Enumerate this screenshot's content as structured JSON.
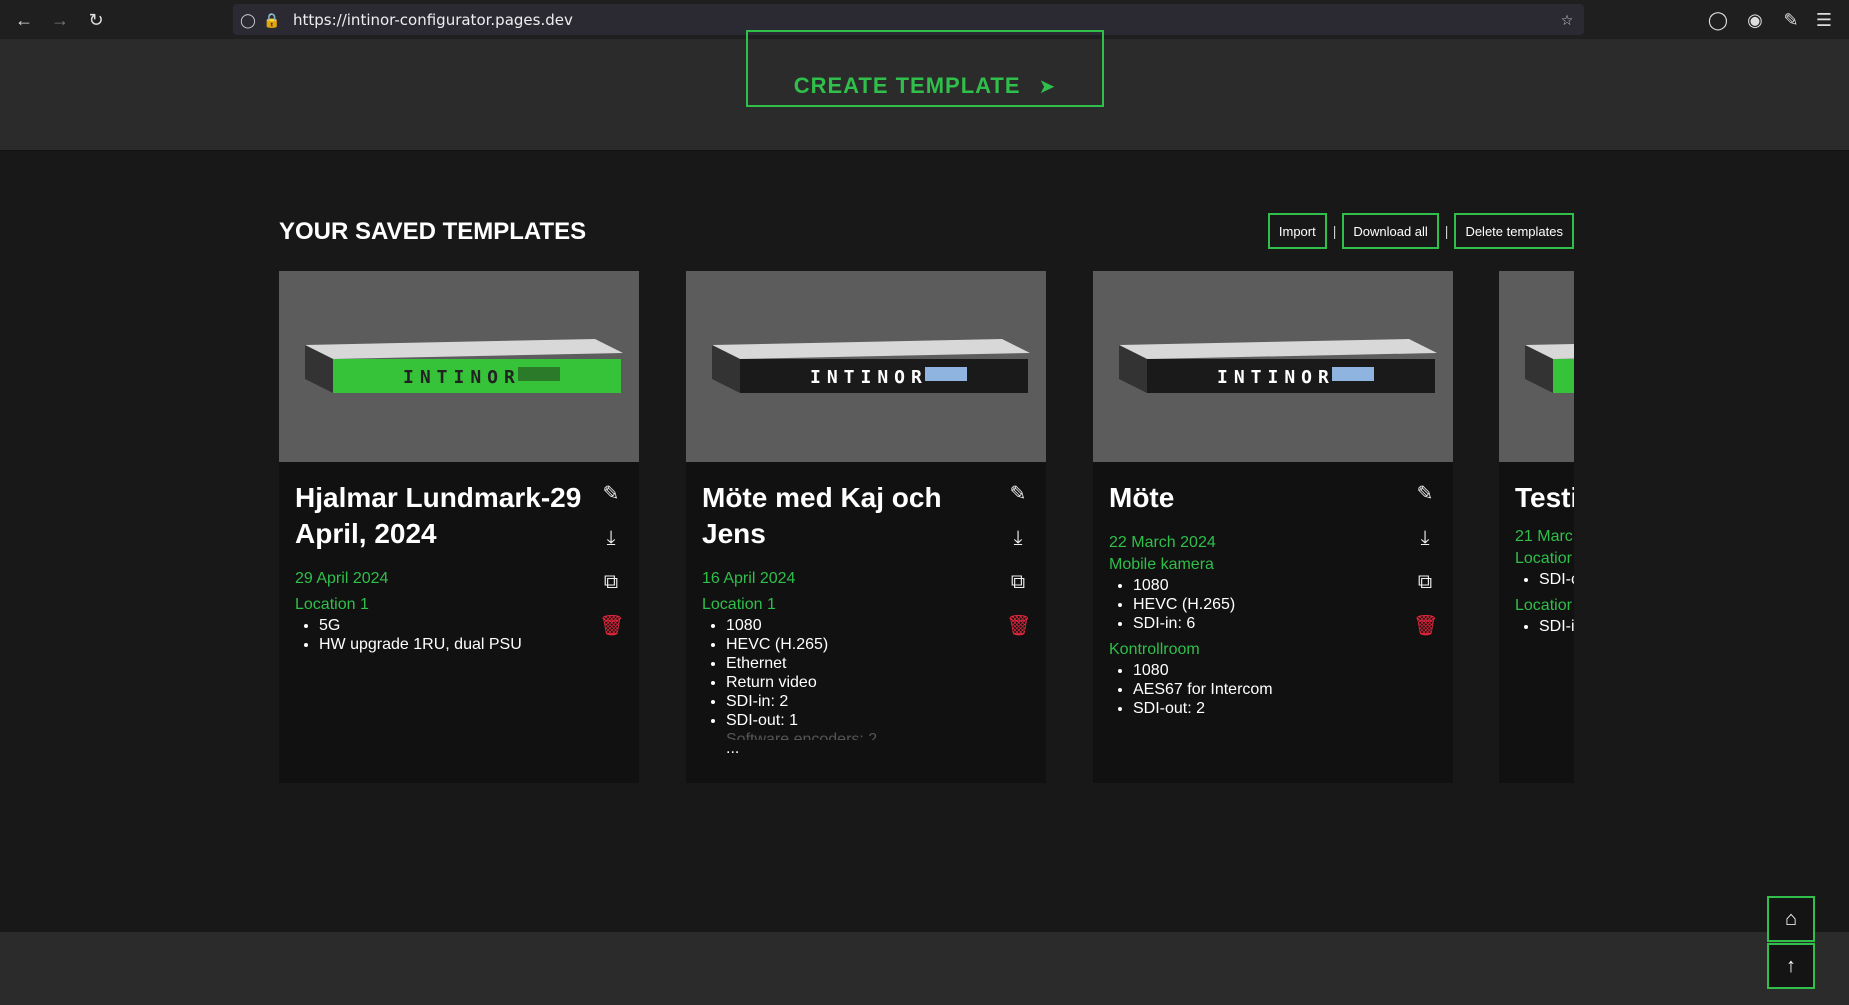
{
  "browser": {
    "url": "https://intinor-configurator.pages.dev"
  },
  "top": {
    "create_button_label": "CREATE TEMPLATE"
  },
  "saved": {
    "title": "YOUR SAVED TEMPLATES",
    "actions": {
      "import": "Import",
      "download_all": "Download all",
      "delete_templates": "Delete templates",
      "separator": "|"
    }
  },
  "cards": [
    {
      "title": "Hjalmar Lundmark-29 April, 2024",
      "date": "29 April 2024",
      "device_color": "#37c339",
      "locations": [
        {
          "name": "Location 1",
          "items": [
            "5G",
            "HW upgrade 1RU, dual PSU"
          ]
        }
      ]
    },
    {
      "title": "Möte med Kaj och Jens",
      "date": "16 April 2024",
      "device_color": "#1a1a1a",
      "locations": [
        {
          "name": "Location 1",
          "items": [
            "1080",
            "HEVC (H.265)",
            "Ethernet",
            "Return video",
            "SDI-in: 2",
            "SDI-out: 1"
          ]
        }
      ],
      "faded_item": "Software encoders: 2",
      "more": "..."
    },
    {
      "title": "Möte",
      "date": "22 March 2024",
      "device_color": "#1a1a1a",
      "locations": [
        {
          "name": "Mobile kamera",
          "items": [
            "1080",
            "HEVC (H.265)",
            "SDI-in: 6"
          ]
        },
        {
          "name": "Kontrollroom",
          "items": [
            "1080",
            "AES67 for Intercom",
            "SDI-out: 2"
          ]
        }
      ]
    },
    {
      "title": "Testi",
      "date": "21 Marc",
      "device_color": "#37c339",
      "locations": [
        {
          "name": "Locatior",
          "items": [
            "SDI-c"
          ]
        },
        {
          "name": "Locatior",
          "items": [
            "SDI-i"
          ]
        }
      ]
    }
  ],
  "icons": {
    "edit": "pencil-icon",
    "download": "download-icon",
    "copy": "copy-icon",
    "delete": "trash-icon",
    "home": "home-icon",
    "up": "arrow-up-icon"
  },
  "colors": {
    "accent": "#2fbf4a",
    "delete": "#e3263c"
  }
}
